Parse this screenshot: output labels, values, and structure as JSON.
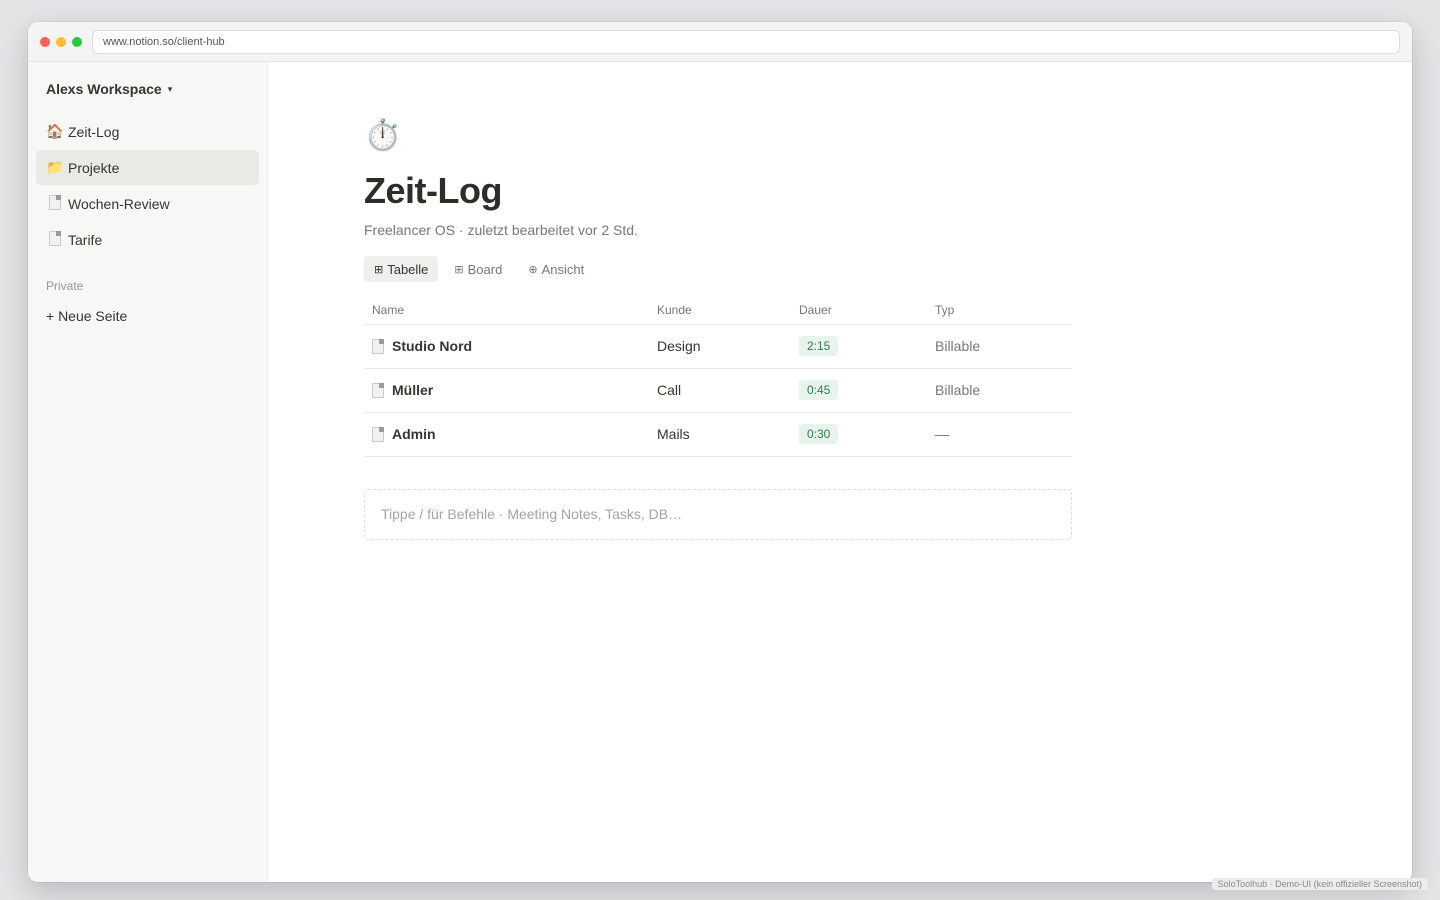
{
  "browser": {
    "url": "www.notion.so/client-hub"
  },
  "sidebar": {
    "workspace": "Alexs Workspace",
    "caret": "▾",
    "items": [
      {
        "icon": "🏠",
        "label": "Zeit-Log"
      },
      {
        "icon": "📁",
        "label": "Projekte"
      },
      {
        "icon": "page-icon",
        "label": "Wochen-Review"
      },
      {
        "icon": "page-icon",
        "label": "Tarife"
      }
    ],
    "section_label": "Private",
    "new_page": "+ Neue Seite"
  },
  "page": {
    "icon": "⏱️",
    "title": "Zeit-Log",
    "subtitle": "Freelancer OS · zuletzt bearbeitet vor 2 Std.",
    "views": [
      {
        "icon": "⊞",
        "label": "Tabelle"
      },
      {
        "icon": "⊞",
        "label": "Board"
      },
      {
        "icon": "⊕",
        "label": "Ansicht"
      }
    ],
    "table": {
      "headers": [
        "Name",
        "Kunde",
        "Dauer",
        "Typ"
      ],
      "rows": [
        {
          "name": "Studio Nord",
          "kunde": "Design",
          "dauer": "2:15",
          "typ": "Billable"
        },
        {
          "name": "Müller",
          "kunde": "Call",
          "dauer": "0:45",
          "typ": "Billable"
        },
        {
          "name": "Admin",
          "kunde": "Mails",
          "dauer": "0:30",
          "typ": "—"
        }
      ]
    },
    "composer_placeholder": "Tippe / für Befehle · Meeting Notes, Tasks, DB…"
  },
  "footnote": "SoloToolhub · Demo-UI (kein offizieller Screenshot)",
  "colors": {
    "accent_badge_bg": "#e8f3ec",
    "accent_badge_text": "#2e7d4f",
    "sidebar_bg": "#f7f7f5"
  }
}
